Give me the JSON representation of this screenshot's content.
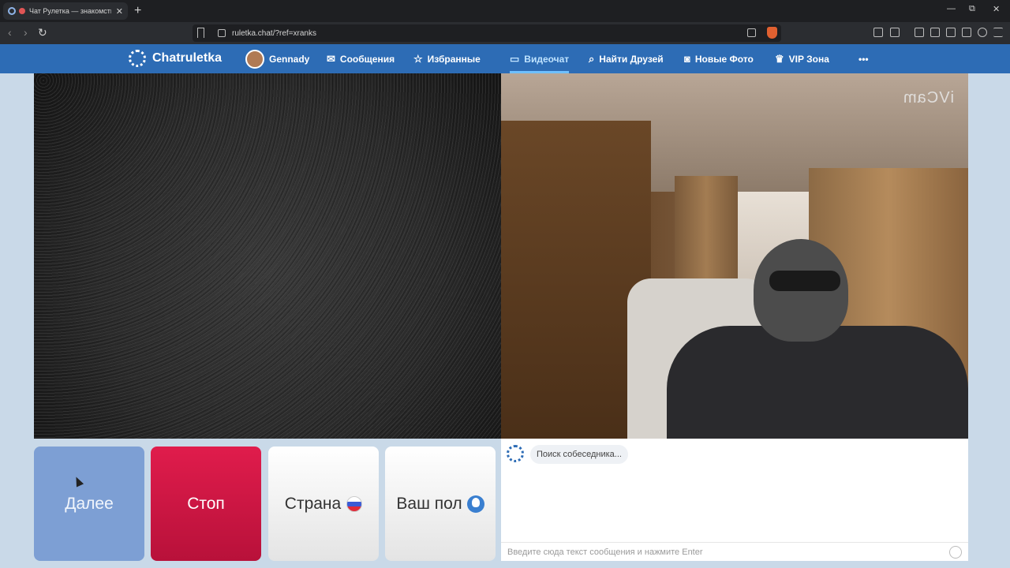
{
  "browser": {
    "tab_title": "Чат Рулетка — знакомства и видео",
    "new_tab_label": "+",
    "close_tab": "✕",
    "url": "ruletka.chat/?ref=xranks",
    "win_min": "—",
    "win_max": "⧉",
    "win_close": "✕"
  },
  "site": {
    "logo_text": "Chatruletka",
    "nav": {
      "profile": "Gennady",
      "messages": "Сообщения",
      "favorites": "Избранные",
      "videochat": "Видеочат",
      "find_friends": "Найти Друзей",
      "new_photos": "Новые Фото",
      "vip": "VIP Зона",
      "more": "•••"
    },
    "accent": "#2d6cb5"
  },
  "video": {
    "watermark": "iVCam"
  },
  "controls": {
    "next": "Далее",
    "stop": "Стоп",
    "country": "Страна",
    "gender": "Ваш пол"
  },
  "chat": {
    "status": "Поиск собеседника...",
    "input_placeholder": "Введите сюда текст сообщения и нажмите Enter"
  }
}
